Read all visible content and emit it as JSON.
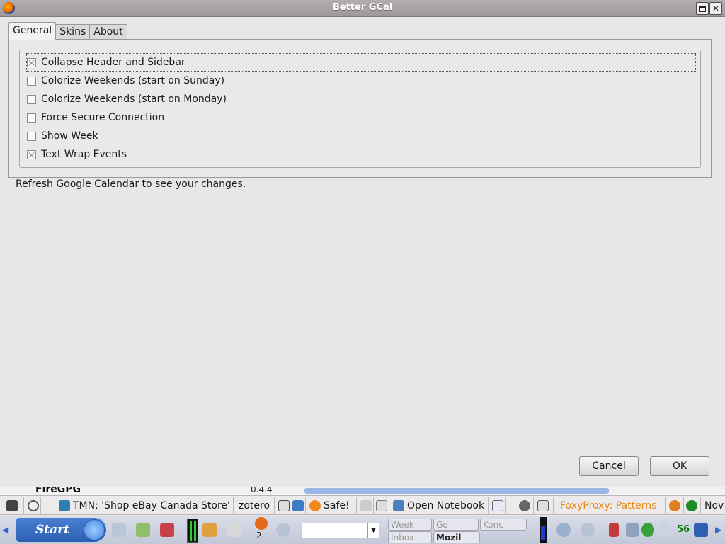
{
  "window": {
    "title": "Better GCal"
  },
  "tabs": [
    {
      "label": "General",
      "active": true
    },
    {
      "label": "Skins",
      "active": false
    },
    {
      "label": "About",
      "active": false
    }
  ],
  "options": [
    {
      "label": "Collapse Header and Sidebar",
      "checked": true
    },
    {
      "label": "Colorize Weekends (start on Sunday)",
      "checked": false
    },
    {
      "label": "Colorize Weekends (start on Monday)",
      "checked": false
    },
    {
      "label": "Force Secure Connection",
      "checked": false
    },
    {
      "label": "Show Week",
      "checked": false
    },
    {
      "label": "Text Wrap Events",
      "checked": true
    }
  ],
  "hint": "Refresh Google Calendar to see your changes.",
  "buttons": {
    "cancel": "Cancel",
    "ok": "OK"
  },
  "background_window": {
    "addon_name": "FireGPG",
    "version": "0.4.4"
  },
  "taskbar_row1": {
    "tmn": "TMN: 'Shop eBay Canada Store'",
    "zotero": "zotero",
    "safe": "Safe!",
    "notebook": "Open Notebook",
    "foxyproxy": "FoxyProxy: Patterns",
    "trailing": "Nov"
  },
  "taskbar_row2": {
    "start_label": "Start",
    "desktop_number": "2",
    "mini_windows": [
      "Week",
      "Go",
      "Konc",
      "Inbox",
      "Mozil"
    ],
    "tray_text": "56"
  },
  "colors": {
    "titlebar": "#a6a2a5",
    "background": "#e9e6e6",
    "accent": "#4a7fd1",
    "foxyproxy_text": "#e88a18"
  }
}
